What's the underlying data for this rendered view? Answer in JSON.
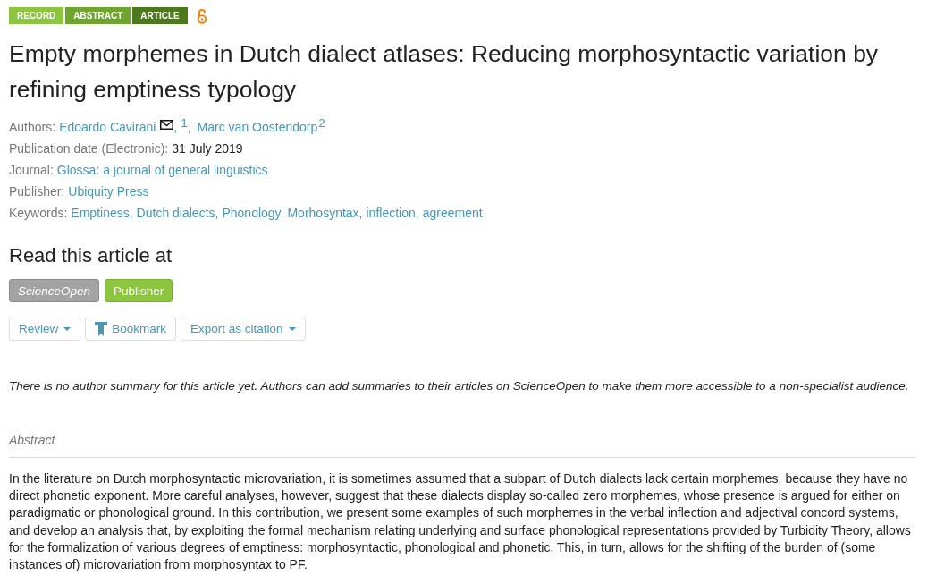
{
  "tags": [
    {
      "label": "RECORD",
      "color": "#8cc63f"
    },
    {
      "label": "ABSTRACT",
      "color": "#6ea52c"
    },
    {
      "label": "ARTICLE",
      "color": "#4c7a1b"
    }
  ],
  "title": "Empty morphemes in Dutch dialect atlases: Reducing morphosyntactic variation by refining emptiness typology",
  "authors": {
    "label": "Authors:",
    "separator": ",",
    "people": [
      {
        "name": "Edoardo Cavirani",
        "email": true,
        "affiliation": "1"
      },
      {
        "name": "Marc van Oostendorp",
        "email": false,
        "affiliation": "2"
      }
    ]
  },
  "fields": [
    {
      "label": "Publication date (Electronic):",
      "value": "31 July 2019",
      "kind": "plain"
    },
    {
      "label": "Journal:",
      "value": "Glossa: a journal of general linguistics",
      "kind": "link"
    },
    {
      "label": "Publisher:",
      "value": "Ubiquity Press",
      "kind": "link"
    }
  ],
  "keywords": {
    "label": "Keywords:",
    "separator": ",",
    "items": [
      "Emptiness",
      "Dutch dialects",
      "Phonology",
      "Morhosyntax",
      "inflection",
      "agreement"
    ]
  },
  "read_at": {
    "heading": "Read this article at",
    "sources": [
      {
        "label": "ScienceOpen",
        "disabled": true
      },
      {
        "label": "Publisher",
        "disabled": false
      }
    ]
  },
  "actions": [
    {
      "label": "Review",
      "kind": "dropdown"
    },
    {
      "label": "Bookmark",
      "kind": "bookmark"
    },
    {
      "label": "Export as citation",
      "kind": "dropdown"
    }
  ],
  "summary_note": "There is no author summary for this article yet. Authors can add summaries to their articles on ScienceOpen to make them more accessible to a non-specialist audience.",
  "abstract": {
    "heading": "Abstract",
    "text": "In the literature on Dutch morphosyntactic microvariation, it is sometimes assumed that a subpart of Dutch dialects lack certain morphemes, because they have no direct phonetic exponent. More careful analyses, however, suggest that these dialects display so-called zero morphemes, whose presence is argued for either on paradigmatic or phonological ground. In this contribution, we present some examples of such morphemes in the verbal inflection and adjectival concord systems, and develop an analysis that, by exploiting the formal mechanism relating underlying and surface phonological representations provided by Turbidity Theory, allows for the formalization of various degrees of emptiness: morphosyntactic, phonological and phonetic. This, in turn, allows for the shifting of the burden of (some instances of) microvariation from morphosyntax to PF."
  }
}
